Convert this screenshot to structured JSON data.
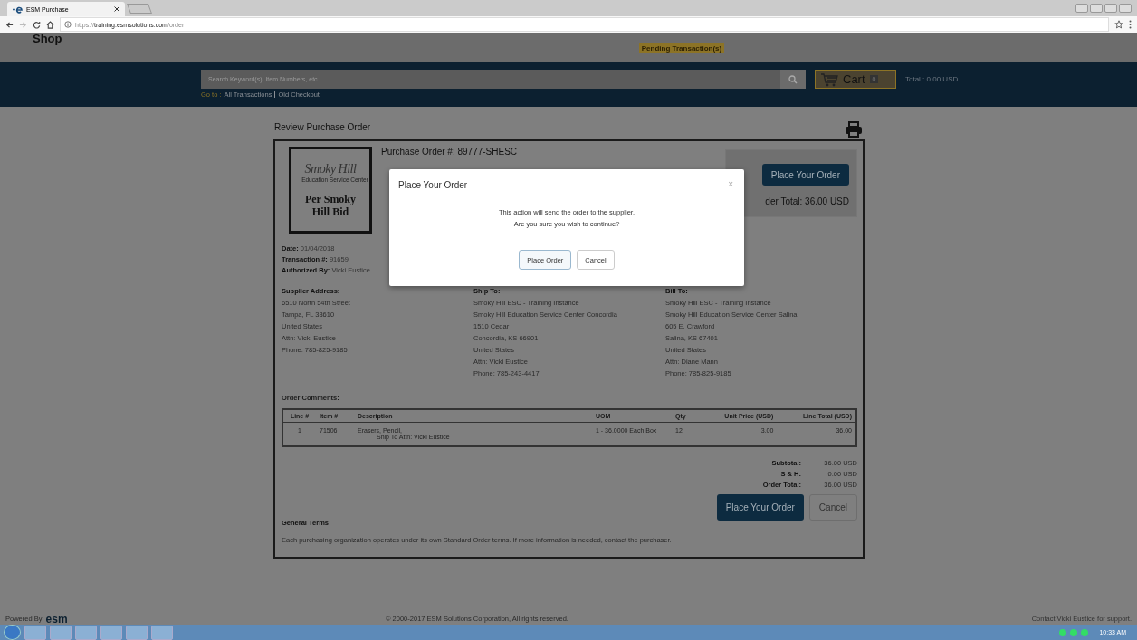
{
  "browser": {
    "tab_title": "ESM Purchase",
    "url_prefix": "https://",
    "url_host": "training.esmsolutions.com",
    "url_path": "/order"
  },
  "header": {
    "title": "Shop",
    "pending": "Pending Transaction(s)",
    "search_placeholder": "Search Keyword(s), Item Numbers, etc.",
    "goto_label": "Go to :",
    "goto_links": [
      "All Transactions",
      "Old Checkout"
    ],
    "cart_label": "Cart",
    "cart_count": "0",
    "total": "Total : 0.00 USD"
  },
  "page": {
    "title": "Review Purchase Order",
    "logo": {
      "name": "Smoky Hill",
      "subtitle": "Education Service Center",
      "stamp": "Per Smoky Hill Bid"
    },
    "po_number": "Purchase Order #: 89777-SHESC",
    "summary": {
      "button": "Place Your Order",
      "total": "der Total: 36.00 USD"
    },
    "meta": [
      {
        "label": "Date:",
        "value": "01/04/2018"
      },
      {
        "label": "Transaction #:",
        "value": "91659"
      },
      {
        "label": "Authorized By:",
        "value": "Vicki Eustice"
      }
    ],
    "addresses": [
      {
        "heading": "Supplier Address:",
        "lines": [
          "6510 North 54th Street",
          "Tampa, FL 33610",
          "United States",
          "Attn: Vicki Eustice",
          "Phone: 785-825-9185"
        ]
      },
      {
        "heading": "Ship To:",
        "lines": [
          "Smoky Hill ESC - Training Instance",
          "Smoky Hill Education Service Center Concordia",
          "1510 Cedar",
          "Concordia, KS 66901",
          "United States",
          "Attn: Vicki Eustice",
          "Phone: 785-243-4417"
        ]
      },
      {
        "heading": "Bill To:",
        "lines": [
          "Smoky Hill ESC - Training Instance",
          "Smoky Hill Education Service Center Salina",
          "605 E. Crawford",
          "Salina, KS 67401",
          "United States",
          "Attn: Diane Mann",
          "Phone: 785-825-9185"
        ]
      }
    ],
    "comments_label": "Order Comments:",
    "table": {
      "columns": [
        "Line #",
        "Item #",
        "Description",
        "UOM",
        "Qty",
        "Unit Price (USD)",
        "Line Total (USD)"
      ],
      "rows": [
        {
          "line": "1",
          "item": "71506",
          "description": "Erasers, Pencil,",
          "note": "Ship To Attn: Vicki Eustice",
          "uom": "1 - 36.0000 Each Box",
          "qty": "12",
          "unit_price": "3.00",
          "line_total": "36.00"
        }
      ]
    },
    "totals": [
      {
        "label": "Subtotal:",
        "value": "36.00 USD"
      },
      {
        "label": "S & H:",
        "value": "0.00 USD"
      },
      {
        "label": "Order Total:",
        "value": "36.00 USD"
      }
    ],
    "actions": {
      "primary": "Place Your Order",
      "secondary": "Cancel"
    },
    "terms": {
      "heading": "General Terms",
      "text": "Each purchasing organization operates under its own Standard Order terms.  If more information is needed, contact the purchaser."
    }
  },
  "footer": {
    "powered_by": "Powered By:",
    "brand": "esm",
    "copyright": "© 2000-2017 ESM Solutions Corporation, All rights reserved.",
    "contact": "Contact Vicki Eustice for support."
  },
  "modal": {
    "title": "Place Your Order",
    "close": "×",
    "message_lines": [
      "This action will send the order to the supplier.",
      "Are you sure you wish to continue?"
    ],
    "confirm": "Place Order",
    "cancel": "Cancel"
  },
  "taskbar": {
    "clock": "10:33 AM"
  }
}
